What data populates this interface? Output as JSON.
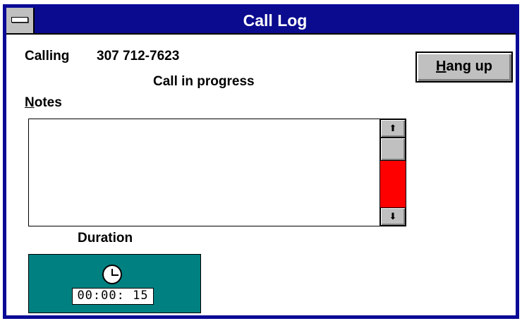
{
  "window": {
    "title": "Call Log"
  },
  "call": {
    "calling_label": "Calling",
    "number": "307 712-7623",
    "status": "Call in progress"
  },
  "hangup": {
    "label_accel": "H",
    "label_rest": "ang up"
  },
  "notes": {
    "label_accel": "N",
    "label_rest": "otes",
    "value": ""
  },
  "scrollbar": {
    "up_glyph": "⬆",
    "down_glyph": "⬇",
    "track_color": "#ff0000"
  },
  "duration": {
    "label": "Duration",
    "time": "00:00: 15"
  },
  "colors": {
    "title_bar": "#0b0b8f",
    "timer_panel": "#008080",
    "button_face": "#c0c0c0"
  },
  "icons": {
    "system_menu": "system-menu-icon",
    "timer": "clock-icon"
  }
}
